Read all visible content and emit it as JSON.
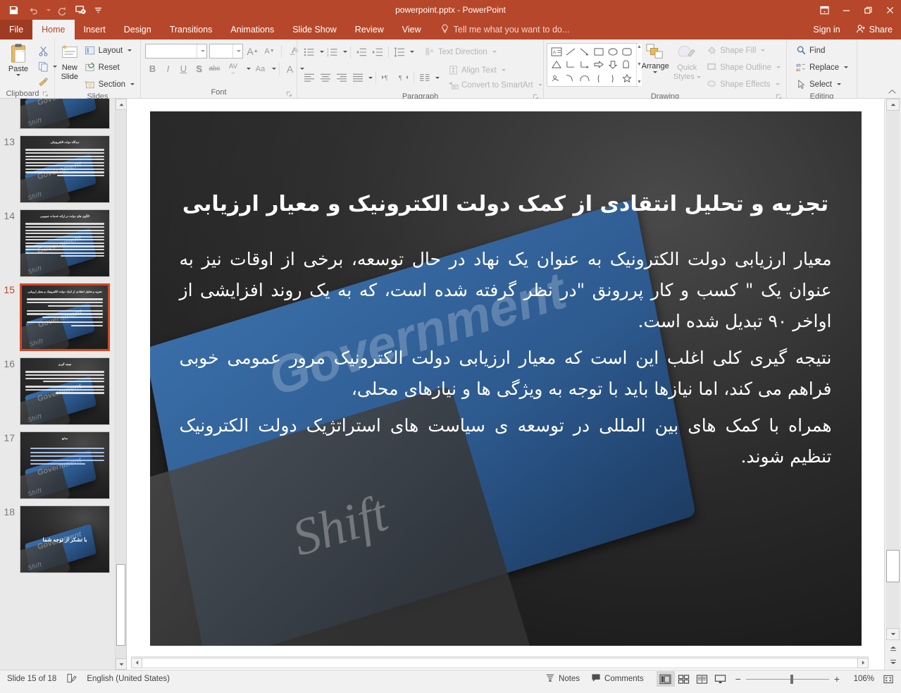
{
  "titlebar": {
    "document_title": "powerpoint.pptx - PowerPoint",
    "quick_access": [
      {
        "name": "save",
        "label": "Save"
      },
      {
        "name": "undo",
        "label": "Undo"
      },
      {
        "name": "redo",
        "label": "Redo"
      },
      {
        "name": "start-from-beginning",
        "label": "Start From Beginning"
      },
      {
        "name": "customize-qat",
        "label": "Customize Quick Access Toolbar"
      }
    ],
    "window_controls": [
      {
        "name": "ribbon-display-options",
        "label": "Ribbon Display Options"
      },
      {
        "name": "minimize",
        "label": "Minimize"
      },
      {
        "name": "restore",
        "label": "Restore Down"
      },
      {
        "name": "close",
        "label": "Close"
      }
    ]
  },
  "tabs": [
    {
      "label": "File",
      "active": false,
      "file": true
    },
    {
      "label": "Home",
      "active": true
    },
    {
      "label": "Insert",
      "active": false
    },
    {
      "label": "Design",
      "active": false
    },
    {
      "label": "Transitions",
      "active": false
    },
    {
      "label": "Animations",
      "active": false
    },
    {
      "label": "Slide Show",
      "active": false
    },
    {
      "label": "Review",
      "active": false
    },
    {
      "label": "View",
      "active": false
    }
  ],
  "tellme": {
    "placeholder": "Tell me what you want to do..."
  },
  "account": {
    "signin": "Sign in",
    "share": "Share"
  },
  "ribbon": {
    "clipboard": {
      "group_label": "Clipboard",
      "paste_label": "Paste",
      "cut_label": "Cut",
      "copy_label": "Copy",
      "format_painter_label": "Format Painter"
    },
    "slides": {
      "group_label": "Slides",
      "new_slide_label": "New\nSlide",
      "new_slide_line1": "New",
      "new_slide_line2": "Slide",
      "layout_label": "Layout",
      "reset_label": "Reset",
      "section_label": "Section"
    },
    "font": {
      "group_label": "Font",
      "font_name_value": "",
      "font_size_value": "",
      "increase_font_label": "A",
      "decrease_font_label": "A",
      "clear_formatting_label": "Clear All Formatting",
      "bold_label": "B",
      "italic_label": "I",
      "underline_label": "U",
      "shadow_label": "S",
      "strikethrough_label": "abc",
      "character_spacing_label": "AV",
      "change_case_label": "Aa",
      "font_color_label": "A"
    },
    "paragraph": {
      "group_label": "Paragraph",
      "text_direction_label": "Text Direction",
      "align_text_label": "Align Text",
      "convert_smartart_label": "Convert to SmartArt"
    },
    "drawing": {
      "group_label": "Drawing",
      "arrange_label": "Arrange",
      "quick_styles_line1": "Quick",
      "quick_styles_line2": "Styles",
      "shape_fill_label": "Shape Fill",
      "shape_outline_label": "Shape Outline",
      "shape_effects_label": "Shape Effects"
    },
    "editing": {
      "group_label": "Editing",
      "find_label": "Find",
      "replace_label": "Replace",
      "select_label": "Select"
    }
  },
  "thumbnails": [
    {
      "number": "12",
      "partial": true,
      "title": "",
      "body_lines": 5,
      "kind": "text"
    },
    {
      "number": "13",
      "title": "دیدگاه دولت الکترونیکی",
      "body_lines": 9,
      "kind": "text"
    },
    {
      "number": "14",
      "title": "الگوی های دولت در ارائه خدمات عمومی",
      "body_lines": 11,
      "kind": "text"
    },
    {
      "number": "15",
      "selected": true,
      "title": "تجزیه و تحلیل انتقادی از کمک دولت الکترونیک و معیار ارزیابی",
      "body_lines": 8,
      "kind": "text"
    },
    {
      "number": "16",
      "title": "نتیجه گیری",
      "body_lines": 7,
      "kind": "text"
    },
    {
      "number": "17",
      "title": "منابع",
      "body_lines": 4,
      "kind": "bullets"
    },
    {
      "number": "18",
      "title": "",
      "center_text": "با تشکر از توجه شما",
      "kind": "thanks"
    }
  ],
  "slide": {
    "title": "تجزیه و تحلیل انتقادی از کمک دولت الکترونیک و معیار ارزیابی",
    "paragraphs": [
      "معیار ارزیابی دولت الکترونیک به عنوان یک نهاد در حال توسعه، برخی از اوقات نیز به عنوان یک \" کسب و کار پررونق \"در نظر گرفته شده است، که به یک روند افزایشی از اواخر ۹۰ تبدیل شده است.",
      "نتیجه گیری کلی اغلب این است که معیار ارزیابی دولت الکترونیک مرور عمومی خوبی فراهم می کند، اما نیازها باید با توجه به ویژگی ها و نیازهای محلی،",
      "همراه با کمک های بین المللی در توسعه ی سیاست های استراتژیک دولت الکترونیک تنظیم شوند."
    ],
    "background_watermarks": {
      "shift_key": "Shift",
      "government_key": "Government"
    }
  },
  "statusbar": {
    "slide_counter": "Slide 15 of 18",
    "spellcheck_name": "spelling-check-icon",
    "language": "English (United States)",
    "notes_label": "Notes",
    "comments_label": "Comments",
    "views": [
      {
        "name": "normal-view",
        "active": true
      },
      {
        "name": "slide-sorter-view",
        "active": false
      },
      {
        "name": "reading-view",
        "active": false
      },
      {
        "name": "slide-show-view",
        "active": false
      }
    ],
    "zoom_out_label": "−",
    "zoom_in_label": "+",
    "zoom_percent": "106%",
    "fit_label": "Fit slide to current window"
  },
  "colors": {
    "accent": "#b7472a",
    "file_tab": "#9e3b22",
    "selection": "#d24726",
    "ribbon_bg": "#f1f1f1"
  }
}
